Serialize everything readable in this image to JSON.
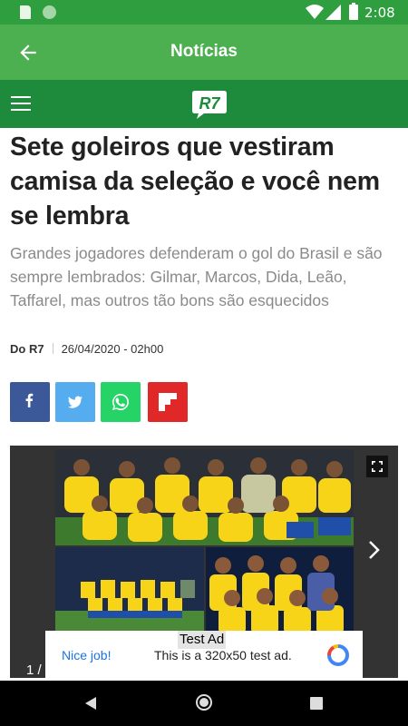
{
  "status_bar": {
    "time": "2:08"
  },
  "app_bar": {
    "title": "Notícias"
  },
  "brand": {
    "logo_text": "R7"
  },
  "article": {
    "headline": "Sete goleiros que vestiram camisa da seleção e você nem se lembra",
    "subtitle": "Grandes jogadores defenderam o gol do Brasil e são sempre lembrados: Gilmar, Marcos, Dida, Leão, Taffarel, mas outros tão bons são esquecidos",
    "author": "Do R7",
    "date": "26/04/2020 - 02h00"
  },
  "share": [
    {
      "network": "facebook",
      "icon": "facebook-icon",
      "color": "#3b5998"
    },
    {
      "network": "twitter",
      "icon": "twitter-icon",
      "color": "#55acee"
    },
    {
      "network": "whatsapp",
      "icon": "whatsapp-icon",
      "color": "#25d366"
    },
    {
      "network": "flipboard",
      "icon": "flipboard-icon",
      "color": "#e12828"
    }
  ],
  "gallery": {
    "counter": "1 /"
  },
  "ad": {
    "label": "Test Ad",
    "nice": "Nice job!",
    "text": "This is a 320x50 test ad."
  },
  "colors": {
    "status": "#2e9e3e",
    "app_bar": "#4caf50",
    "brand_bar": "#1e8a3c",
    "jersey": "#f7d417",
    "shorts": "#1f4fa8"
  }
}
